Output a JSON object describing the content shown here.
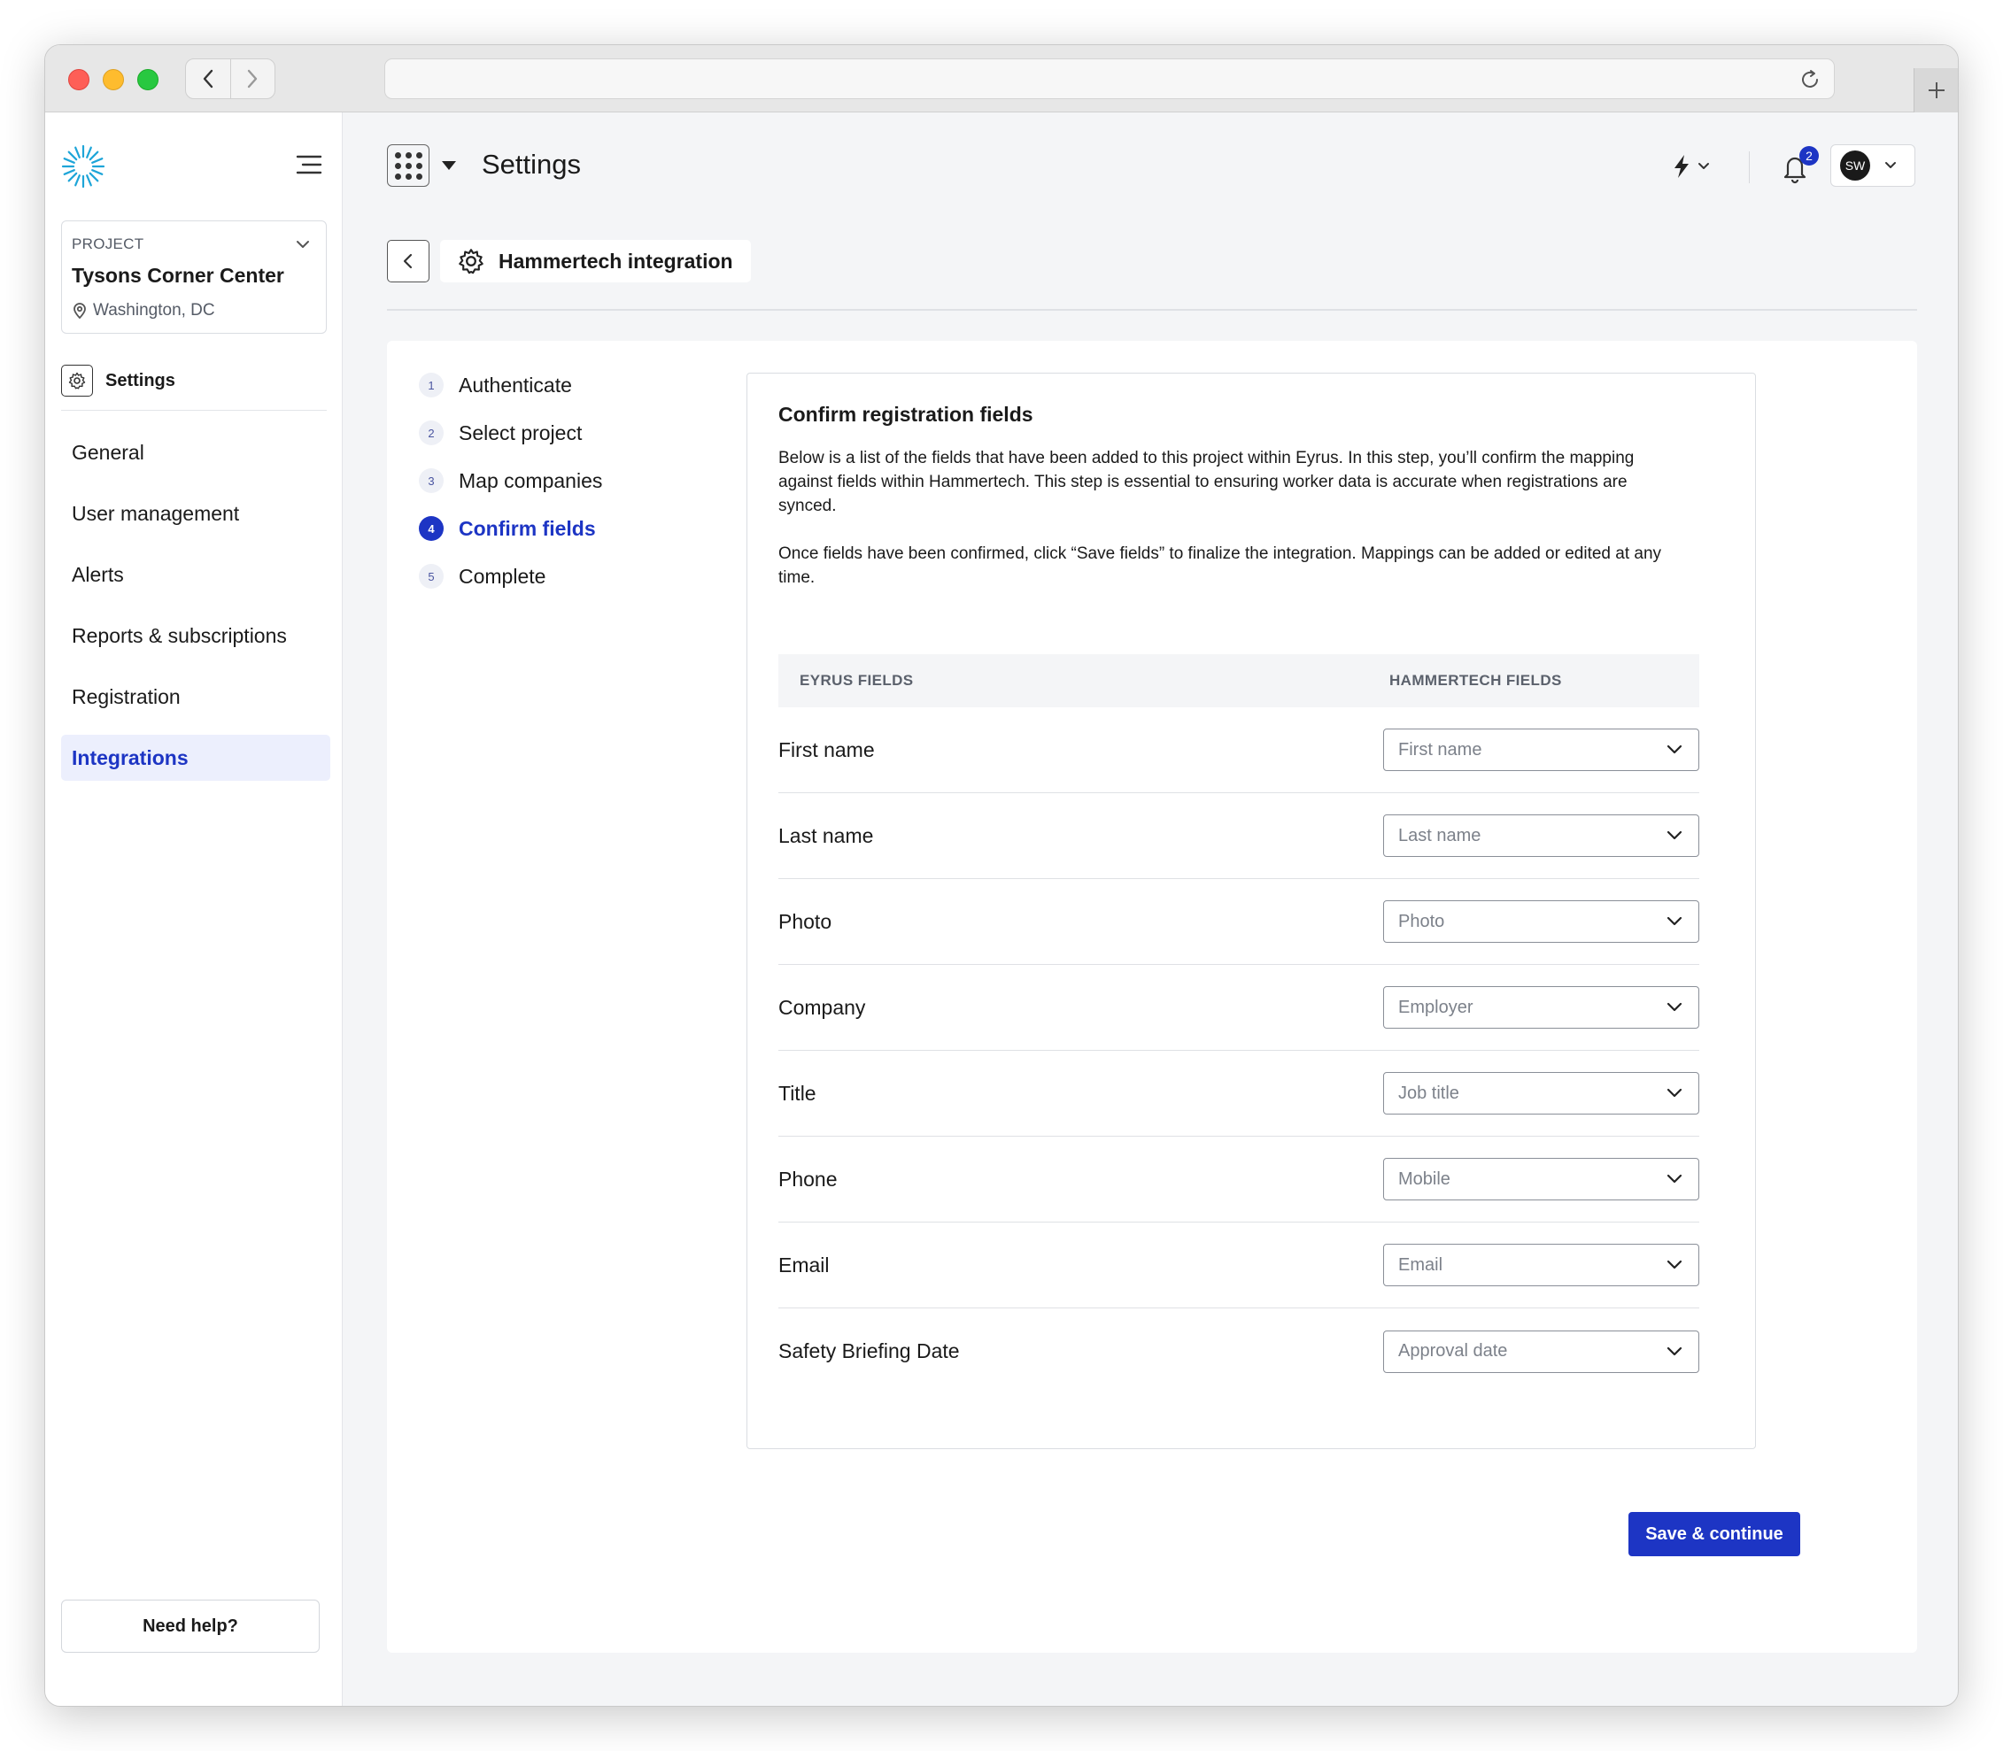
{
  "sidebar": {
    "project_label": "PROJECT",
    "project_name": "Tysons Corner Center",
    "project_location": "Washington, DC",
    "section_title": "Settings",
    "items": [
      {
        "label": "General",
        "active": false
      },
      {
        "label": "User management",
        "active": false
      },
      {
        "label": "Alerts",
        "active": false
      },
      {
        "label": "Reports & subscriptions",
        "active": false
      },
      {
        "label": "Registration",
        "active": false
      },
      {
        "label": "Integrations",
        "active": true
      }
    ],
    "help_label": "Need help?"
  },
  "header": {
    "title": "Settings",
    "notification_count": "2",
    "user_initials": "SW"
  },
  "breadcrumb": {
    "label": "Hammertech integration"
  },
  "steps": [
    {
      "num": "1",
      "label": "Authenticate"
    },
    {
      "num": "2",
      "label": "Select project"
    },
    {
      "num": "3",
      "label": "Map companies"
    },
    {
      "num": "4",
      "label": "Confirm fields"
    },
    {
      "num": "5",
      "label": "Complete"
    }
  ],
  "card": {
    "title": "Confirm registration fields",
    "desc1": "Below is a list of the fields that have been added to this project within Eyrus. In this step, you’ll confirm the mapping against fields within Hammertech. This step is essential to ensuring worker data is accurate when registrations are synced.",
    "desc2": "Once fields have been confirmed, click “Save fields” to finalize the integration. Mappings can be added or edited at any time.",
    "col_eyrus": "EYRUS FIELDS",
    "col_hammertech": "HAMMERTECH FIELDS",
    "rows": [
      {
        "eyrus": "First name",
        "hammertech": "First name"
      },
      {
        "eyrus": "Last name",
        "hammertech": "Last name"
      },
      {
        "eyrus": "Photo",
        "hammertech": "Photo"
      },
      {
        "eyrus": "Company",
        "hammertech": "Employer"
      },
      {
        "eyrus": "Title",
        "hammertech": "Job title"
      },
      {
        "eyrus": "Phone",
        "hammertech": "Mobile"
      },
      {
        "eyrus": "Email",
        "hammertech": "Email"
      },
      {
        "eyrus": "Safety Briefing Date",
        "hammertech": "Approval date"
      }
    ]
  },
  "actions": {
    "save_label": "Save & continue"
  },
  "colors": {
    "accent": "#1d35c4",
    "active_nav_bg": "#eceffd"
  }
}
